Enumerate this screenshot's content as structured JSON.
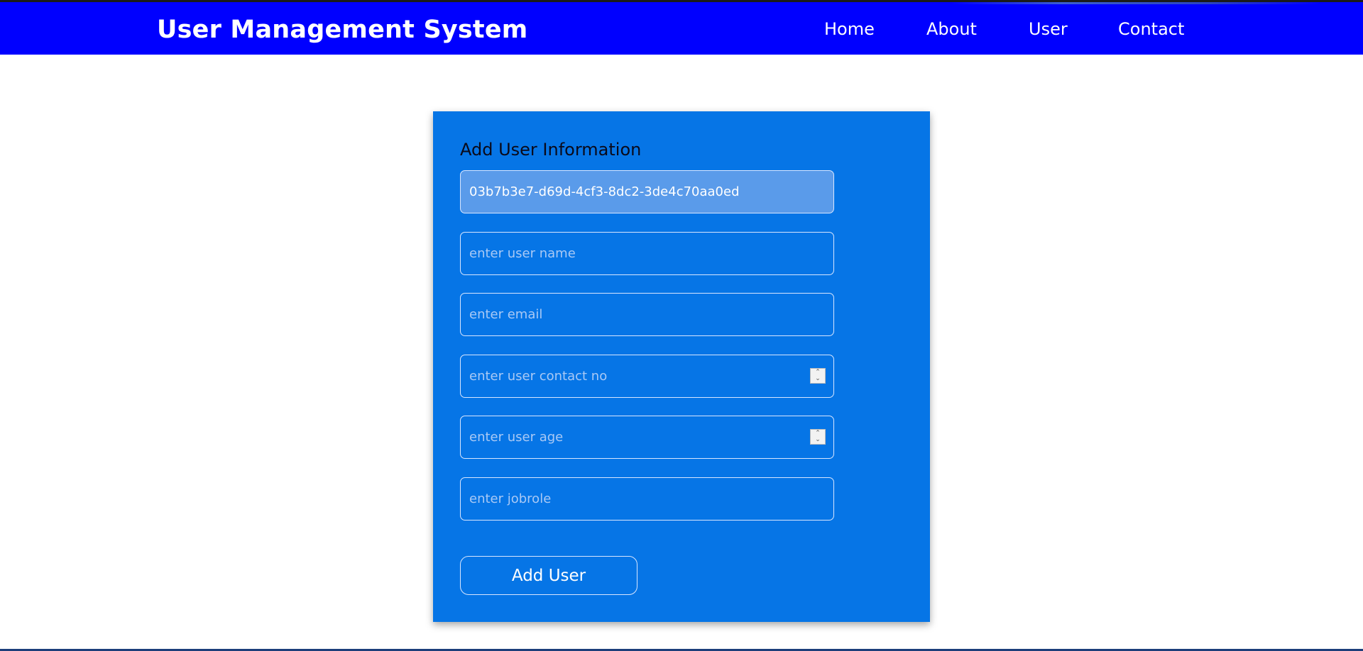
{
  "navbar": {
    "brand": "User Management System",
    "links": [
      {
        "label": "Home"
      },
      {
        "label": "About"
      },
      {
        "label": "User"
      },
      {
        "label": "Contact"
      }
    ],
    "background_color": "#0000ff"
  },
  "form": {
    "title": "Add User Information",
    "id_value": "03b7b3e7-d69d-4cf3-8dc2-3de4c70aa0ed",
    "fields": {
      "username": {
        "placeholder": "enter user name",
        "value": ""
      },
      "email": {
        "placeholder": "enter email",
        "value": ""
      },
      "contact": {
        "placeholder": "enter user contact no",
        "value": ""
      },
      "age": {
        "placeholder": "enter user age",
        "value": ""
      },
      "jobrole": {
        "placeholder": "enter jobrole",
        "value": ""
      }
    },
    "submit_label": "Add User",
    "card_color": "#0675e6"
  }
}
